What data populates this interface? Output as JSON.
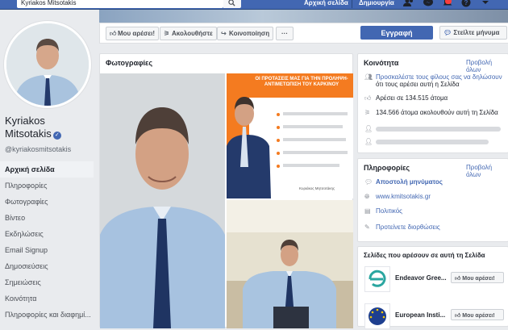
{
  "topbar": {
    "search_value": "Kyriakos Mitsotakis",
    "home_label": "Αρχική σελίδα",
    "create_label": "Δημιουργία"
  },
  "profile": {
    "name_line1": "Kyriakos",
    "name_line2": "Mitsotakis",
    "handle": "@kyriakosmitsotakis",
    "verified_icon": "checkmark-icon"
  },
  "leftnav": {
    "items": [
      {
        "label": "Αρχική σελίδα"
      },
      {
        "label": "Πληροφορίες"
      },
      {
        "label": "Φωτογραφίες"
      },
      {
        "label": "Βίντεο"
      },
      {
        "label": "Εκδηλώσεις"
      },
      {
        "label": "Email Signup"
      },
      {
        "label": "Δημοσιεύσεις"
      },
      {
        "label": "Σημειώσεις"
      },
      {
        "label": "Κοινότητα"
      },
      {
        "label": "Πληροφορίες και διαφημί..."
      }
    ]
  },
  "actions": {
    "like_label": "Μου αρέσει!",
    "follow_label": "Ακολουθήστε",
    "share_label": "Κοινοποίηση",
    "more_label": "···",
    "signup_label": "Εγγραφή",
    "message_label": "Στείλτε μήνυμα"
  },
  "photos": {
    "title": "Φωτογραφίες",
    "poster": {
      "heading": "ΟΙ ΠΡΟΤΑΣΕΙΣ ΜΑΣ ΓΙΑ ΤΗΝ ΠΡΟΛΗΨΗ-ΑΝΤΙΜΕΤΩΠΙΣΗ ΤΟΥ ΚΑΡΚΙΝΟΥ",
      "signature": "Κυριάκος Μητσοτάκης"
    }
  },
  "community": {
    "title": "Κοινότητα",
    "see_all": "Προβολή όλων",
    "invite_text_1": "Προσκαλέστε τους φίλους σας να δηλώσουν",
    "invite_text_2": "ότι τους αρέσει αυτή η Σελίδα",
    "likes_text": "Αρέσει σε 134.515 άτομα",
    "follows_text": "134.566 άτομα ακολουθούν αυτή τη Σελίδα"
  },
  "info": {
    "title": "Πληροφορίες",
    "see_all": "Προβολή όλων",
    "send_message": "Αποστολή μηνύματος",
    "website": "www.kmitsotakis.gr",
    "category": "Πολιτικός",
    "suggest": "Προτείνετε διορθώσεις"
  },
  "liked_pages": {
    "title": "Σελίδες που αρέσουν σε αυτή τη Σελίδα",
    "pages": [
      {
        "name": "Endeavor Gree...",
        "button": "Μου αρέσει!"
      },
      {
        "name": "European Insti...",
        "button": "Μου αρέσει!"
      }
    ]
  },
  "colors": {
    "brand": "#4267b2",
    "orange": "#f47b20"
  }
}
